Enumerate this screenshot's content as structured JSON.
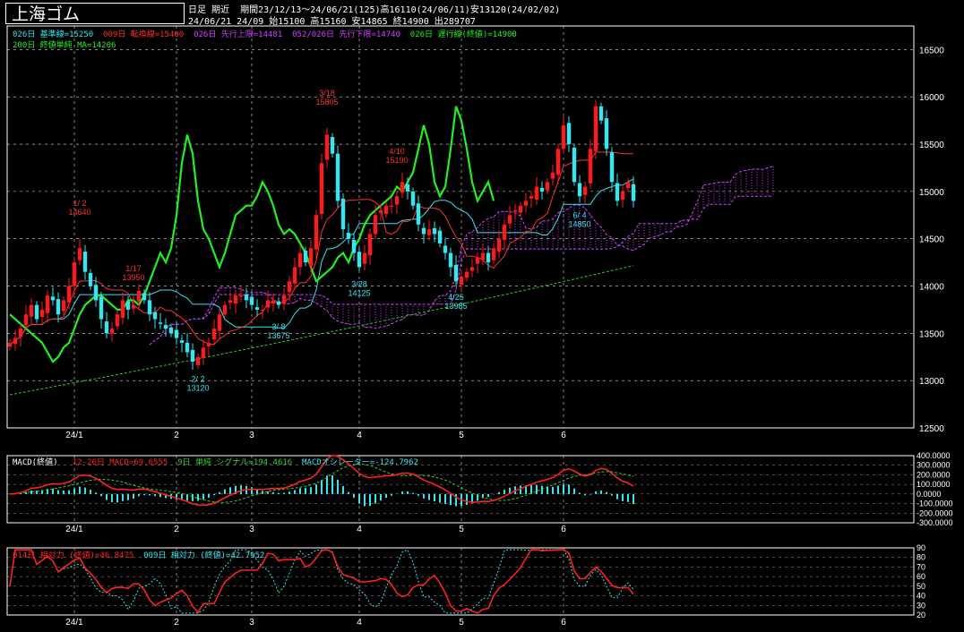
{
  "header": {
    "title": "上海ゴム",
    "chart_type": "日足",
    "contract": "期近",
    "period_summary": "期間23/12/13～24/06/21(125)高16110(24/06/11)安13120(24/02/02)",
    "ohlc_summary": "24/06/21 24/09 始15100 高15160 安14865 終14900 出289707"
  },
  "indicators": {
    "kijun": "026日 基準線=15250",
    "tenkan": "009日 転換線=15400",
    "senkou_a": "026日 先行上限=14481",
    "senkou_b": "052/026日 先行下限=14740",
    "chikou": "026日 遅行線(終値)=14900",
    "ma200": "200日 終値単純 MA=14206"
  },
  "macd_header": {
    "name": "MACD(終値)",
    "macd": "12-26日 MACD=69.6555",
    "signal": "9日 単純 シグナル=194.4616",
    "osc": "MACDオシレーター=-124.7962"
  },
  "rsi_header": {
    "rsi14": "014日 相対力 (終値)=46.8475",
    "rsi9": "009日 相対力 (終値)=42.7952"
  },
  "colors": {
    "up": "#ff1a1a",
    "down": "#33e6f0",
    "kijun": "#33e6f0",
    "tenkan": "#ff3030",
    "cloud": "#d040ff",
    "chikou": "#22ee22",
    "ma200": "#22cc22",
    "grid": "#ffffff",
    "axis_text": "#ffffff",
    "macd_line": "#ff2020",
    "macd_signal": "#30d030",
    "macd_osc": "#33e6f0",
    "rsi14": "#ff2020",
    "rsi9": "#33e6f0"
  },
  "chart_data": {
    "type": "candlestick",
    "ylim": [
      12500,
      16750
    ],
    "y_ticks": [
      12500,
      13000,
      13500,
      14000,
      14500,
      15000,
      15500,
      16000,
      16500
    ],
    "x_tick_labels": [
      {
        "label": "24/1",
        "index": 12
      },
      {
        "label": "2",
        "index": 31
      },
      {
        "label": "3",
        "index": 45
      },
      {
        "label": "4",
        "index": 65
      },
      {
        "label": "5",
        "index": 84
      },
      {
        "label": "6",
        "index": 103
      }
    ],
    "annotations": [
      {
        "date": "1/ 2",
        "value": "14640",
        "index": 13,
        "price": 14640,
        "where": "above",
        "color": "red"
      },
      {
        "date": "1/17",
        "value": "13950",
        "index": 23,
        "price": 13950,
        "where": "above",
        "color": "red"
      },
      {
        "date": "2/ 2",
        "value": "13120",
        "index": 35,
        "price": 13120,
        "where": "below",
        "color": "cyan"
      },
      {
        "date": "3/ 8",
        "value": "13675",
        "index": 50,
        "price": 13675,
        "where": "below",
        "color": "cyan"
      },
      {
        "date": "3/18",
        "value": "15805",
        "index": 59,
        "price": 15805,
        "where": "above",
        "color": "red"
      },
      {
        "date": "3/28",
        "value": "14125",
        "index": 65,
        "price": 14125,
        "where": "below",
        "color": "cyan"
      },
      {
        "date": "4/10",
        "value": "15190",
        "index": 72,
        "price": 15190,
        "where": "above",
        "color": "red"
      },
      {
        "date": "4/25",
        "value": "13985",
        "index": 83,
        "price": 13985,
        "where": "below",
        "color": "cyan"
      },
      {
        "date": "6/ 4",
        "value": "14850",
        "index": 106,
        "price": 14850,
        "where": "below",
        "color": "cyan"
      }
    ],
    "closes": [
      13400,
      13450,
      13550,
      13700,
      13800,
      13650,
      13750,
      13900,
      13850,
      13700,
      13850,
      14000,
      14250,
      14400,
      14150,
      14000,
      13850,
      13650,
      13500,
      13550,
      13700,
      13850,
      13750,
      13800,
      13950,
      13850,
      13700,
      13650,
      13600,
      13550,
      13500,
      13450,
      13400,
      13300,
      13200,
      13250,
      13350,
      13400,
      13550,
      13700,
      13800,
      13850,
      13900,
      13900,
      13850,
      13800,
      13750,
      13750,
      13850,
      13850,
      13800,
      13900,
      14050,
      14200,
      14350,
      14250,
      14400,
      14750,
      15300,
      15600,
      15400,
      14900,
      14600,
      14500,
      14350,
      14200,
      14350,
      14550,
      14750,
      14800,
      14850,
      14850,
      14950,
      15100,
      15000,
      14850,
      14650,
      14550,
      14600,
      14550,
      14450,
      14350,
      14200,
      14050,
      14100,
      14150,
      14200,
      14300,
      14350,
      14250,
      14400,
      14500,
      14650,
      14750,
      14800,
      14850,
      14900,
      14950,
      15050,
      15000,
      15100,
      15200,
      15450,
      15700,
      15500,
      15100,
      14950,
      15050,
      15450,
      15900,
      15750,
      15450,
      15100,
      14900,
      15000,
      15100,
      14900
    ]
  }
}
